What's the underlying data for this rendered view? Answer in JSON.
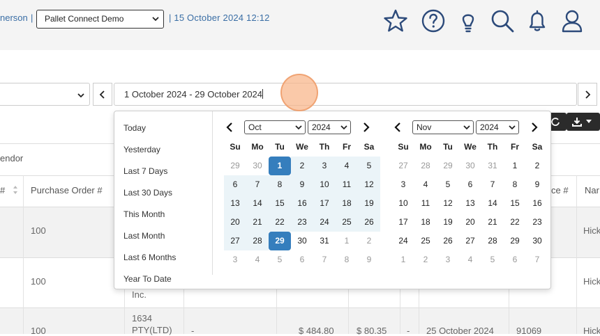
{
  "header": {
    "user_fragment": "nerson",
    "separator": "|",
    "company_select": "Pallet Connect Demo",
    "datetime": "| 15 October 2024 12:12",
    "icons": [
      "star-icon",
      "help-icon",
      "lightbulb-icon",
      "search-icon",
      "bell-icon",
      "user-icon"
    ]
  },
  "filters": {
    "date_range_value": "1 October 2024 - 29 October 2024"
  },
  "table": {
    "vendor_label": "endor",
    "headers": {
      "hash_col": "#",
      "purchase_order": "Purchase Order #",
      "invoice_frag": "ce #",
      "name_frag": "Nar"
    },
    "rows": [
      {
        "po": "100",
        "name": "Hick"
      },
      {
        "po": "100",
        "company": "Inc.",
        "name": "Hick"
      },
      {
        "po": "100",
        "company_line1": "1634",
        "company_line2": "PTY(LTD)",
        "dash1": "-",
        "amount": "$ 484.80",
        "tax": "$ 80.35",
        "dash2": "-",
        "date": "25 October 2024",
        "invoice": "91069",
        "name": "Hick"
      }
    ]
  },
  "picker": {
    "ranges": [
      "Today",
      "Yesterday",
      "Last 7 Days",
      "Last 30 Days",
      "This Month",
      "Last Month",
      "Last 6 Months",
      "Year To Date"
    ],
    "weekdays": [
      "Su",
      "Mo",
      "Tu",
      "We",
      "Th",
      "Fr",
      "Sa"
    ],
    "left": {
      "month": "Oct",
      "year": "2024",
      "days": [
        [
          "29",
          "30",
          "1",
          "2",
          "3",
          "4",
          "5"
        ],
        [
          "6",
          "7",
          "8",
          "9",
          "10",
          "11",
          "12"
        ],
        [
          "13",
          "14",
          "15",
          "16",
          "17",
          "18",
          "19"
        ],
        [
          "20",
          "21",
          "22",
          "23",
          "24",
          "25",
          "26"
        ],
        [
          "27",
          "28",
          "29",
          "30",
          "31",
          "1",
          "2"
        ],
        [
          "3",
          "4",
          "5",
          "6",
          "7",
          "8",
          "9"
        ]
      ]
    },
    "right": {
      "month": "Nov",
      "year": "2024",
      "days": [
        [
          "27",
          "28",
          "29",
          "30",
          "31",
          "1",
          "2"
        ],
        [
          "3",
          "4",
          "5",
          "6",
          "7",
          "8",
          "9"
        ],
        [
          "10",
          "11",
          "12",
          "13",
          "14",
          "15",
          "16"
        ],
        [
          "17",
          "18",
          "19",
          "20",
          "21",
          "22",
          "23"
        ],
        [
          "24",
          "25",
          "26",
          "27",
          "28",
          "29",
          "30"
        ],
        [
          "1",
          "2",
          "3",
          "4",
          "5",
          "6",
          "7"
        ]
      ]
    },
    "range_start": "1",
    "range_end": "29"
  }
}
